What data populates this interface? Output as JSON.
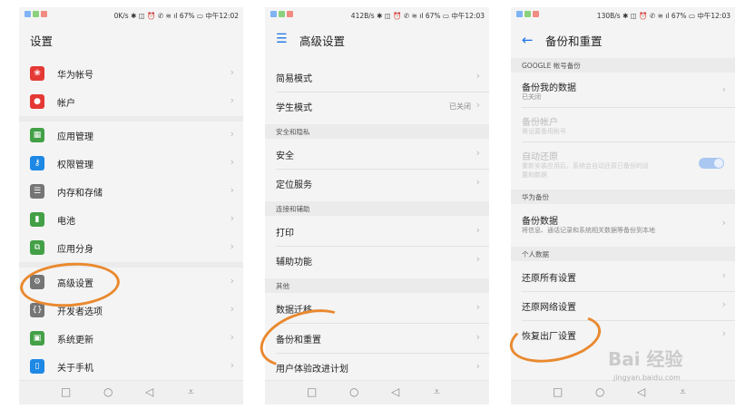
{
  "colors": {
    "accent": "#1a73e8",
    "annotation": "#e9892f"
  },
  "screen1": {
    "status_speed": "0K/s",
    "status_battery": "67%",
    "status_time": "中午12:02",
    "title": "设置",
    "items": [
      {
        "label": "华为帐号",
        "icon": "huawei-icon",
        "color": "#e53935"
      },
      {
        "label": "帐户",
        "icon": "account-icon",
        "color": "#e53935"
      },
      {
        "label": "应用管理",
        "icon": "apps-icon",
        "color": "#43a047"
      },
      {
        "label": "权限管理",
        "icon": "key-icon",
        "color": "#1e88e5"
      },
      {
        "label": "内存和存储",
        "icon": "storage-icon",
        "color": "#757575"
      },
      {
        "label": "电池",
        "icon": "battery-icon",
        "color": "#43a047"
      },
      {
        "label": "应用分身",
        "icon": "clone-icon",
        "color": "#43a047"
      },
      {
        "label": "高级设置",
        "icon": "gear-icon",
        "color": "#757575"
      },
      {
        "label": "开发者选项",
        "icon": "braces-icon",
        "color": "#757575"
      },
      {
        "label": "系统更新",
        "icon": "update-icon",
        "color": "#43a047"
      },
      {
        "label": "关于手机",
        "icon": "phone-icon",
        "color": "#1e88e5"
      }
    ]
  },
  "screen2": {
    "status_speed": "412B/s",
    "status_battery": "67%",
    "status_time": "中午12:03",
    "title": "高级设置",
    "items": {
      "simple_mode": "简易模式",
      "student_mode": "学生模式",
      "student_mode_value": "已关闭",
      "sec_security": "安全和隐私",
      "security": "安全",
      "location": "定位服务",
      "sec_connect": "连接和辅助",
      "print": "打印",
      "assist": "辅助功能",
      "sec_other": "其他",
      "migrate": "数据迁移",
      "backup_reset": "备份和重置",
      "ux_plan": "用户体验改进计划"
    }
  },
  "screen3": {
    "status_speed": "130B/s",
    "status_battery": "67%",
    "status_time": "中午12:03",
    "title": "备份和重置",
    "sec_google": "GOOGLE 帐号备份",
    "backup_my_data": "备份我的数据",
    "backup_my_data_sub": "已关闭",
    "backup_account": "备份帐户",
    "backup_account_sub": "需设置备用帐号",
    "auto_restore": "自动还原",
    "auto_restore_sub1": "重新安装应用后，系统会自动还原已备份的设",
    "auto_restore_sub2": "置和数据",
    "sec_huawei": "华为备份",
    "backup_data": "备份数据",
    "backup_data_sub": "将信息、通话记录和系统相关数据等备份到本地",
    "sec_personal": "个人数据",
    "reset_all": "还原所有设置",
    "reset_network": "还原网络设置",
    "factory_reset": "恢复出厂设置"
  },
  "watermark": {
    "brand": "Bai 经验",
    "url": "jingyan.baidu.com"
  }
}
